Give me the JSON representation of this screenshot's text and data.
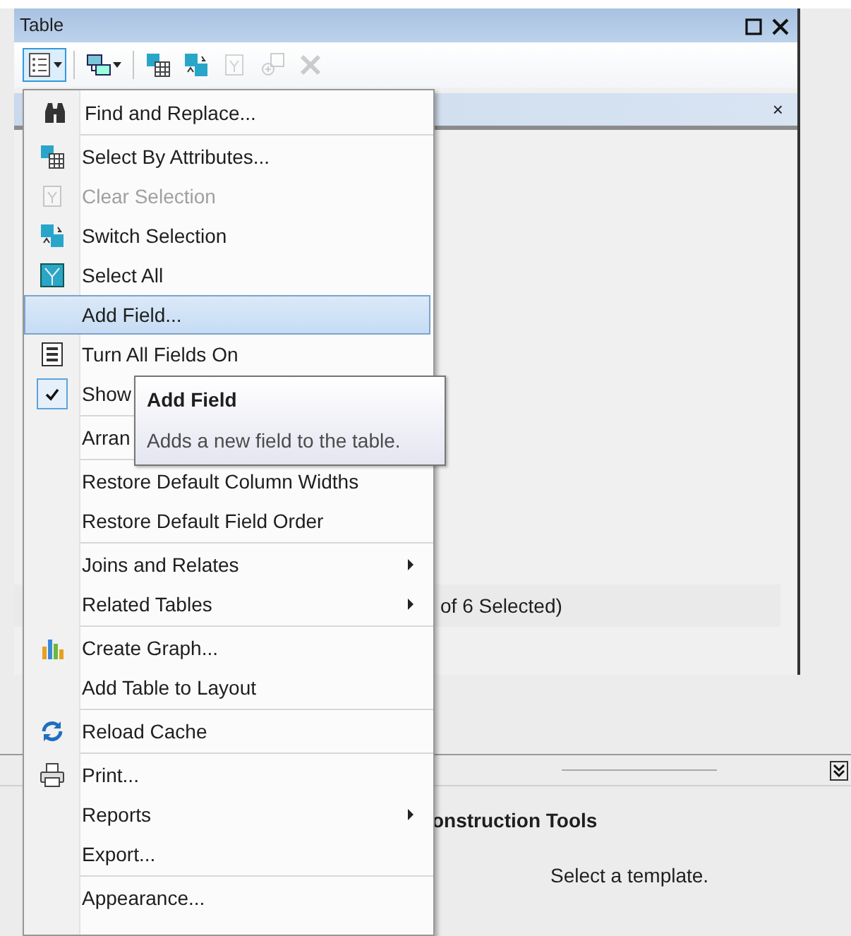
{
  "window": {
    "title": "Table"
  },
  "toolbar": [
    {
      "disabled": false,
      "selected": true
    },
    {
      "disabled": false,
      "selected": false
    },
    {
      "disabled": false,
      "selected": false
    },
    {
      "disabled": false,
      "selected": false
    },
    {
      "disabled": true,
      "selected": false
    },
    {
      "disabled": true,
      "selected": false
    },
    {
      "disabled": true,
      "selected": false
    }
  ],
  "table_tab": {
    "close": "×"
  },
  "status_text": "of 6 Selected)",
  "lower_panel": {
    "title": "onstruction Tools",
    "message": "Select a template."
  },
  "menu": {
    "groups": [
      {
        "items": [
          {
            "label": "Find and Replace...",
            "kind": "plain",
            "disabled": false,
            "selected": false
          }
        ]
      },
      {
        "items": [
          {
            "label": "Select By Attributes...",
            "kind": "plain",
            "disabled": false,
            "selected": false
          },
          {
            "label": "Clear Selection",
            "kind": "plain",
            "disabled": true,
            "selected": false
          },
          {
            "label": "Switch Selection",
            "kind": "plain",
            "disabled": false,
            "selected": false
          },
          {
            "label": "Select All",
            "kind": "plain",
            "disabled": false,
            "selected": false
          },
          {
            "label": "Add Field...",
            "kind": "plain",
            "disabled": false,
            "selected": true
          },
          {
            "label": "Turn All Fields On",
            "kind": "plain",
            "disabled": false,
            "selected": false
          },
          {
            "label": "Show",
            "kind": "check",
            "checked": true,
            "disabled": false,
            "selected": false
          }
        ]
      },
      {
        "items": [
          {
            "label": "Arran",
            "kind": "plain",
            "disabled": false,
            "selected": false
          }
        ]
      },
      {
        "items": [
          {
            "label": "Restore Default Column Widths",
            "kind": "plain",
            "disabled": false,
            "selected": false
          },
          {
            "label": "Restore Default Field Order",
            "kind": "plain",
            "disabled": false,
            "selected": false
          }
        ]
      },
      {
        "items": [
          {
            "label": "Joins and Relates",
            "kind": "submenu",
            "disabled": false,
            "selected": false
          },
          {
            "label": "Related Tables",
            "kind": "submenu",
            "disabled": false,
            "selected": false
          }
        ]
      },
      {
        "items": [
          {
            "label": "Create Graph...",
            "kind": "plain",
            "disabled": false,
            "selected": false
          },
          {
            "label": "Add Table to Layout",
            "kind": "plain",
            "disabled": false,
            "selected": false
          }
        ]
      },
      {
        "items": [
          {
            "label": "Reload Cache",
            "kind": "plain",
            "disabled": false,
            "selected": false
          }
        ]
      },
      {
        "items": [
          {
            "label": "Print...",
            "kind": "plain",
            "disabled": false,
            "selected": false
          },
          {
            "label": "Reports",
            "kind": "submenu",
            "disabled": false,
            "selected": false
          },
          {
            "label": "Export...",
            "kind": "plain",
            "disabled": false,
            "selected": false
          }
        ]
      },
      {
        "items": [
          {
            "label": "Appearance...",
            "kind": "plain",
            "disabled": false,
            "selected": false
          }
        ]
      }
    ]
  },
  "tooltip": {
    "title": "Add Field",
    "text": "Adds a new field to the table."
  }
}
